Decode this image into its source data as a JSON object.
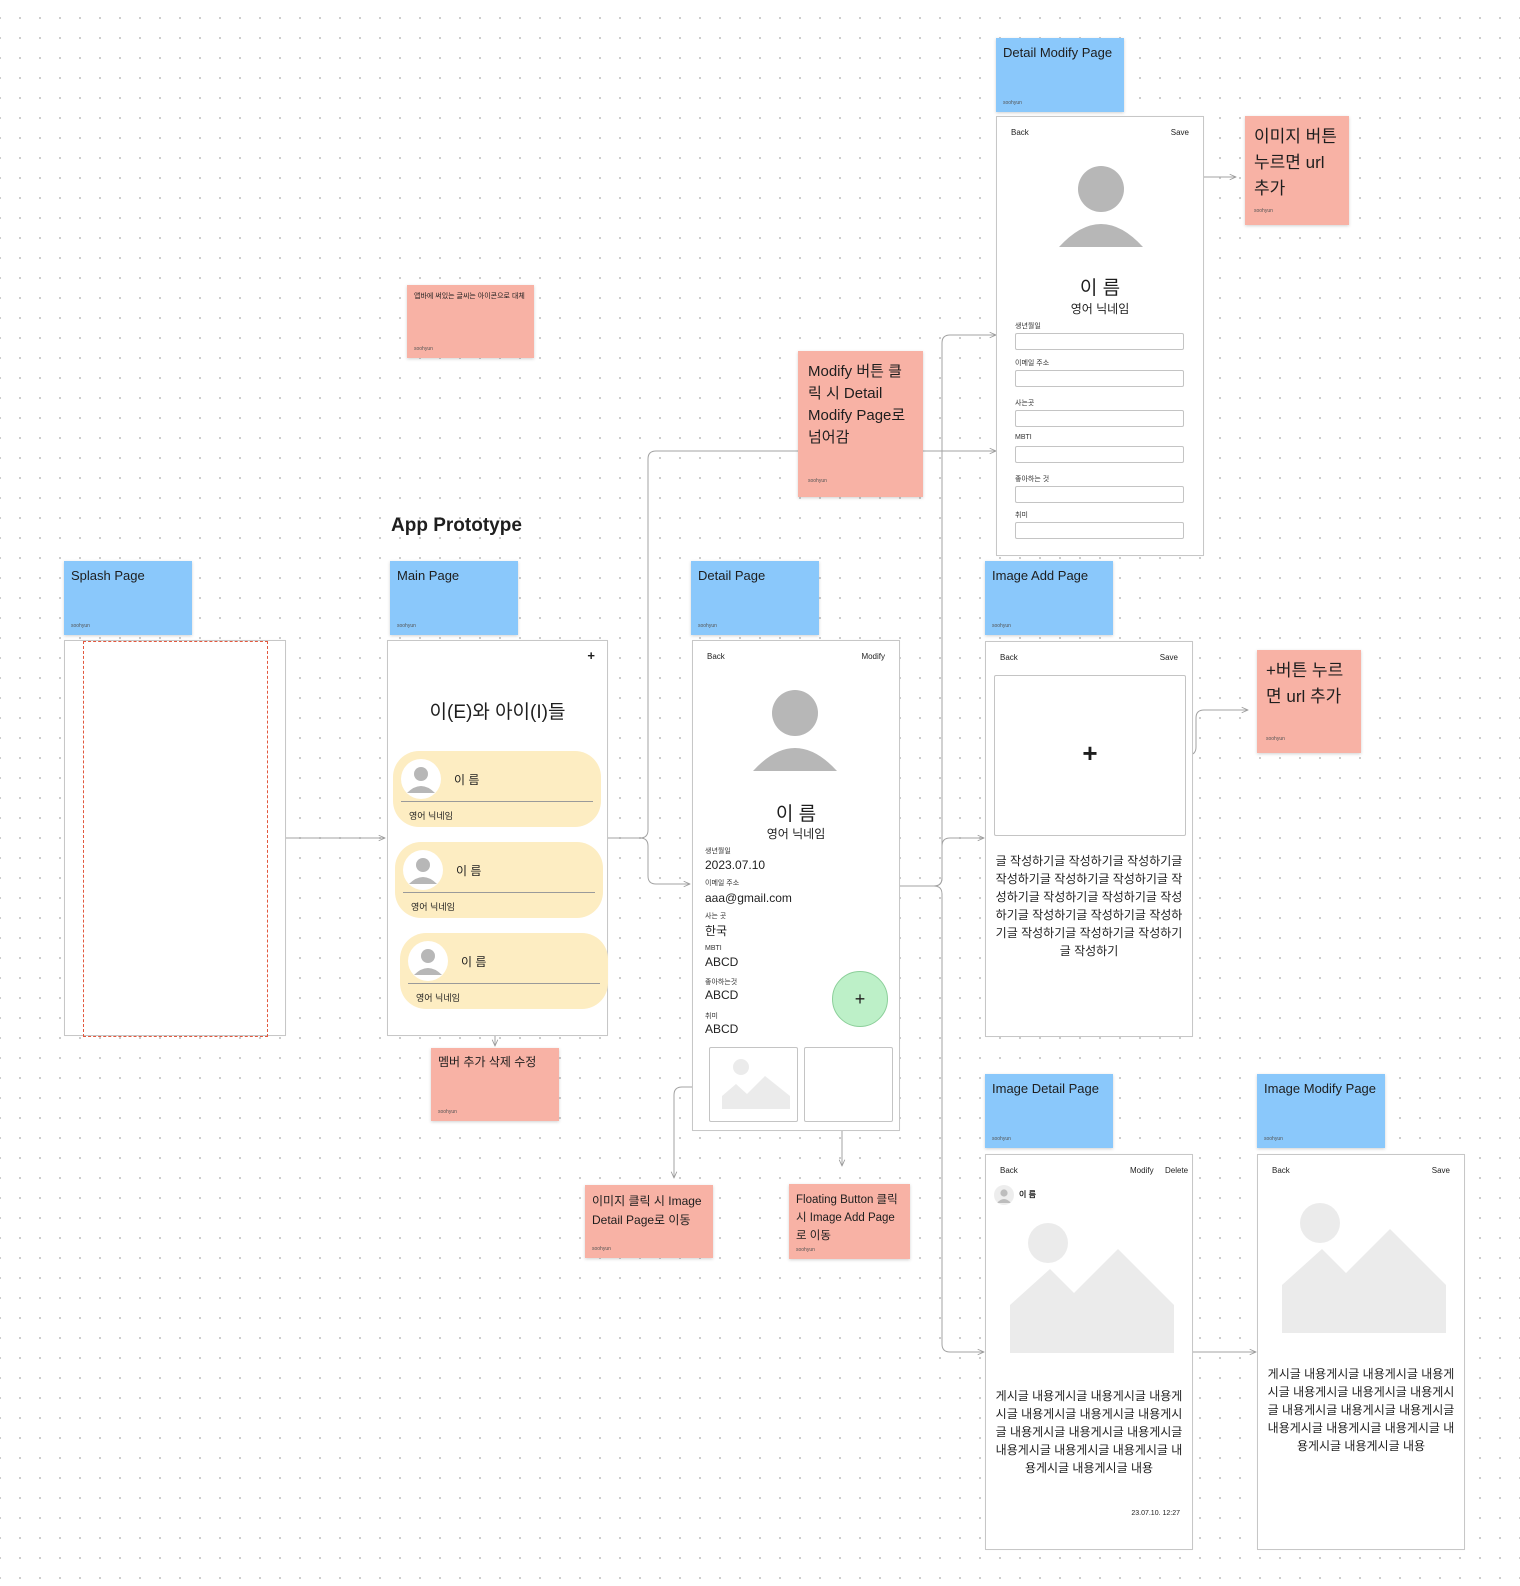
{
  "board": {
    "title": "App Prototype"
  },
  "labels": {
    "splash": {
      "title": "Splash Page",
      "author": "soohyun"
    },
    "main": {
      "title": "Main Page",
      "author": "soohyun"
    },
    "detail": {
      "title": "Detail Page",
      "author": "soohyun"
    },
    "detail_modify": {
      "title": "Detail Modify Page",
      "author": "soohyun"
    },
    "image_add": {
      "title": "Image Add Page",
      "author": "soohyun"
    },
    "image_detail": {
      "title": "Image Detail Page",
      "author": "soohyun"
    },
    "image_modify": {
      "title": "Image Modify Page",
      "author": "soohyun"
    }
  },
  "notes": {
    "navbar_icons": {
      "text": "앱바에 써있는 글씨는 아이콘으로 대체",
      "author": "soohyun"
    },
    "modify_button": {
      "text": "Modify 버튼 클릭 시 Detail Modify Page로 넘어감",
      "author": "soohyun"
    },
    "image_button_url": {
      "text": "이미지 버튼 누르면 url 추가",
      "author": "soohyun"
    },
    "plus_button_url": {
      "text": "+버튼 누르면 url 추가",
      "author": "soohyun"
    },
    "member_crud": {
      "text": "멤버 추가 삭제 수정",
      "author": "soohyun"
    },
    "image_click": {
      "text": "이미지 클릭 시 Image Detail Page로 이동",
      "author": "soohyun"
    },
    "fab_click": {
      "text": "Floating Button 클릭 시 Image Add Page로 이동",
      "author": "soohyun"
    }
  },
  "main_page": {
    "add_icon": "+",
    "app_title": "이(E)와 아이(I)들",
    "members": [
      {
        "name": "이 름",
        "nickname": "영어 닉네임"
      },
      {
        "name": "이 름",
        "nickname": "영어 닉네임"
      },
      {
        "name": "이 름",
        "nickname": "영어 닉네임"
      }
    ]
  },
  "detail_page": {
    "back": "Back",
    "modify": "Modify",
    "name": "이 름",
    "nickname": "영어 닉네임",
    "fields": [
      {
        "label": "생년월일",
        "value": "2023.07.10"
      },
      {
        "label": "이메일 주소",
        "value": "aaa@gmail.com"
      },
      {
        "label": "사는 곳",
        "value": "한국"
      },
      {
        "label": "MBTI",
        "value": "ABCD"
      },
      {
        "label": "좋아하는것",
        "value": "ABCD"
      },
      {
        "label": "취미",
        "value": "ABCD"
      }
    ],
    "fab_icon": "+"
  },
  "detail_modify_page": {
    "back": "Back",
    "save": "Save",
    "name": "이 름",
    "nickname": "영어 닉네임",
    "fields": [
      {
        "label": "생년월일",
        "value": ""
      },
      {
        "label": "이메일 주소",
        "value": ""
      },
      {
        "label": "사는곳",
        "value": ""
      },
      {
        "label": "MBTI",
        "value": ""
      },
      {
        "label": "좋아하는 것",
        "value": ""
      },
      {
        "label": "취미",
        "value": ""
      }
    ]
  },
  "image_add_page": {
    "back": "Back",
    "save": "Save",
    "add_icon": "+",
    "body": "글 작성하기글 작성하기글 작성하기글 작성하기글 작성하기글 작성하기글 작성하기글 작성하기글 작성하기글 작성하기글 작성하기글 작성하기글 작성하기글 작성하기글 작성하기글 작성하기글 작성하기"
  },
  "image_detail_page": {
    "back": "Back",
    "modify": "Modify",
    "delete": "Delete",
    "author_name": "이 름",
    "body": "게시글 내용게시글 내용게시글 내용게시글 내용게시글 내용게시글 내용게시글 내용게시글 내용게시글 내용게시글 내용게시글 내용게시글 내용게시글 내용게시글 내용게시글 내용",
    "timestamp": "23.07.10. 12:27"
  },
  "image_modify_page": {
    "back": "Back",
    "save": "Save",
    "body": "게시글 내용게시글 내용게시글 내용게시글 내용게시글 내용게시글 내용게시글 내용게시글 내용게시글 내용게시글 내용게시글 내용게시글 내용게시글 내용게시글 내용게시글 내용"
  }
}
